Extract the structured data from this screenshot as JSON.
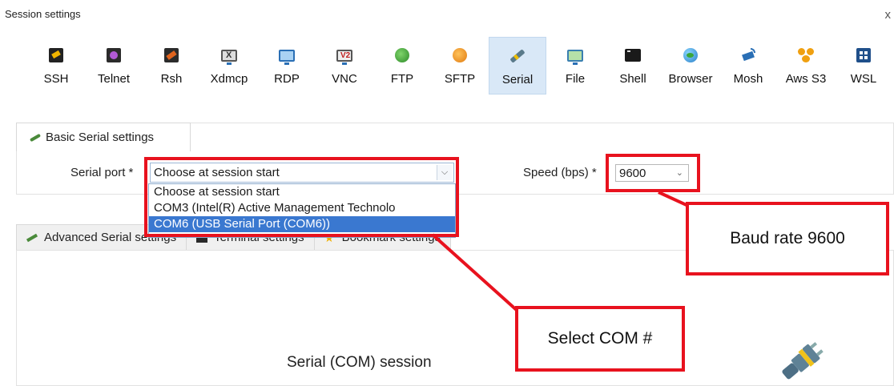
{
  "window": {
    "title": "Session settings",
    "close": "x"
  },
  "toolbar": {
    "items": [
      {
        "label": "SSH",
        "icon": "ssh-icon"
      },
      {
        "label": "Telnet",
        "icon": "telnet-icon"
      },
      {
        "label": "Rsh",
        "icon": "rsh-icon"
      },
      {
        "label": "Xdmcp",
        "icon": "xdmcp-icon"
      },
      {
        "label": "RDP",
        "icon": "rdp-icon"
      },
      {
        "label": "VNC",
        "icon": "vnc-icon"
      },
      {
        "label": "FTP",
        "icon": "ftp-icon"
      },
      {
        "label": "SFTP",
        "icon": "sftp-icon"
      },
      {
        "label": "Serial",
        "icon": "serial-icon",
        "active": true
      },
      {
        "label": "File",
        "icon": "file-icon"
      },
      {
        "label": "Shell",
        "icon": "shell-icon"
      },
      {
        "label": "Browser",
        "icon": "browser-icon"
      },
      {
        "label": "Mosh",
        "icon": "mosh-icon"
      },
      {
        "label": "Aws S3",
        "icon": "aws-s3-icon"
      },
      {
        "label": "WSL",
        "icon": "wsl-icon"
      }
    ]
  },
  "basic": {
    "tab_label": "Basic Serial settings",
    "serial_port_label": "Serial port *",
    "serial_port_value": "Choose at session start",
    "serial_port_options": [
      "Choose at session start",
      "COM3  (Intel(R) Active Management Technolo",
      "COM6  (USB Serial Port (COM6))"
    ],
    "selected_option_index": 2,
    "speed_label": "Speed (bps) *",
    "speed_value": "9600"
  },
  "lower_tabs": [
    "Advanced Serial settings",
    "Terminal settings",
    "Bookmark settings"
  ],
  "panel": {
    "session_text": "Serial (COM) session"
  },
  "annotations": {
    "baud_callout": "Baud rate 9600",
    "com_callout": "Select COM #",
    "color": "#e8121e"
  },
  "colors": {
    "active_tab_bg": "#d9e8f7",
    "selected_option_bg": "#3a78d0"
  }
}
